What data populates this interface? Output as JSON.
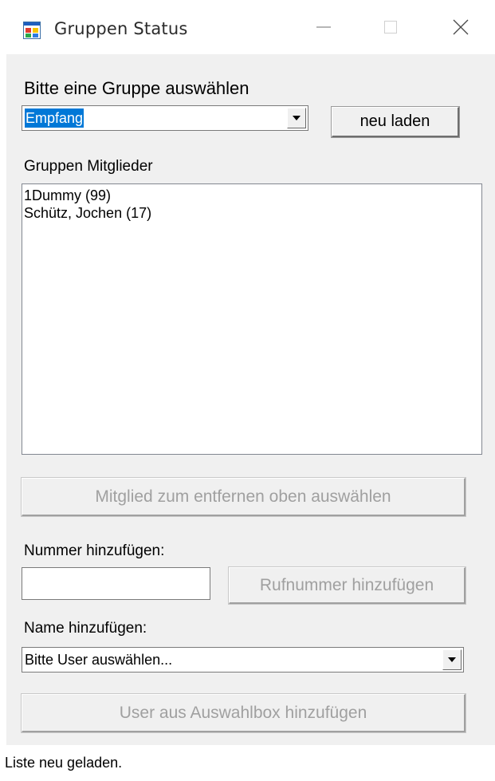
{
  "window": {
    "title": "Gruppen Status",
    "icon": "windows-form-icon"
  },
  "titlebar_controls": {
    "minimize_icon": "minimize-icon",
    "maximize_icon": "maximize-icon",
    "close_icon": "close-icon"
  },
  "group_select": {
    "label": "Bitte eine Gruppe auswählen",
    "selected_value": "Empfang",
    "reload_label": "neu laden"
  },
  "members": {
    "label": "Gruppen Mitglieder",
    "items": [
      "1Dummy (99)",
      "Schütz, Jochen (17)"
    ],
    "remove_label": "Mitglied zum entfernen oben auswählen"
  },
  "add_number": {
    "label": "Nummer hinzufügen:",
    "value": "",
    "button_label": "Rufnummer hinzufügen"
  },
  "add_name": {
    "label": "Name hinzufügen:",
    "selected_value": "Bitte User auswählen...",
    "button_label": "User aus Auswahlbox hinzufügen"
  },
  "status": {
    "text": "Liste neu geladen."
  },
  "colors": {
    "client_background": "#f0f0f0",
    "selection_highlight": "#0078d7",
    "disabled_text": "#a0a0a0"
  }
}
